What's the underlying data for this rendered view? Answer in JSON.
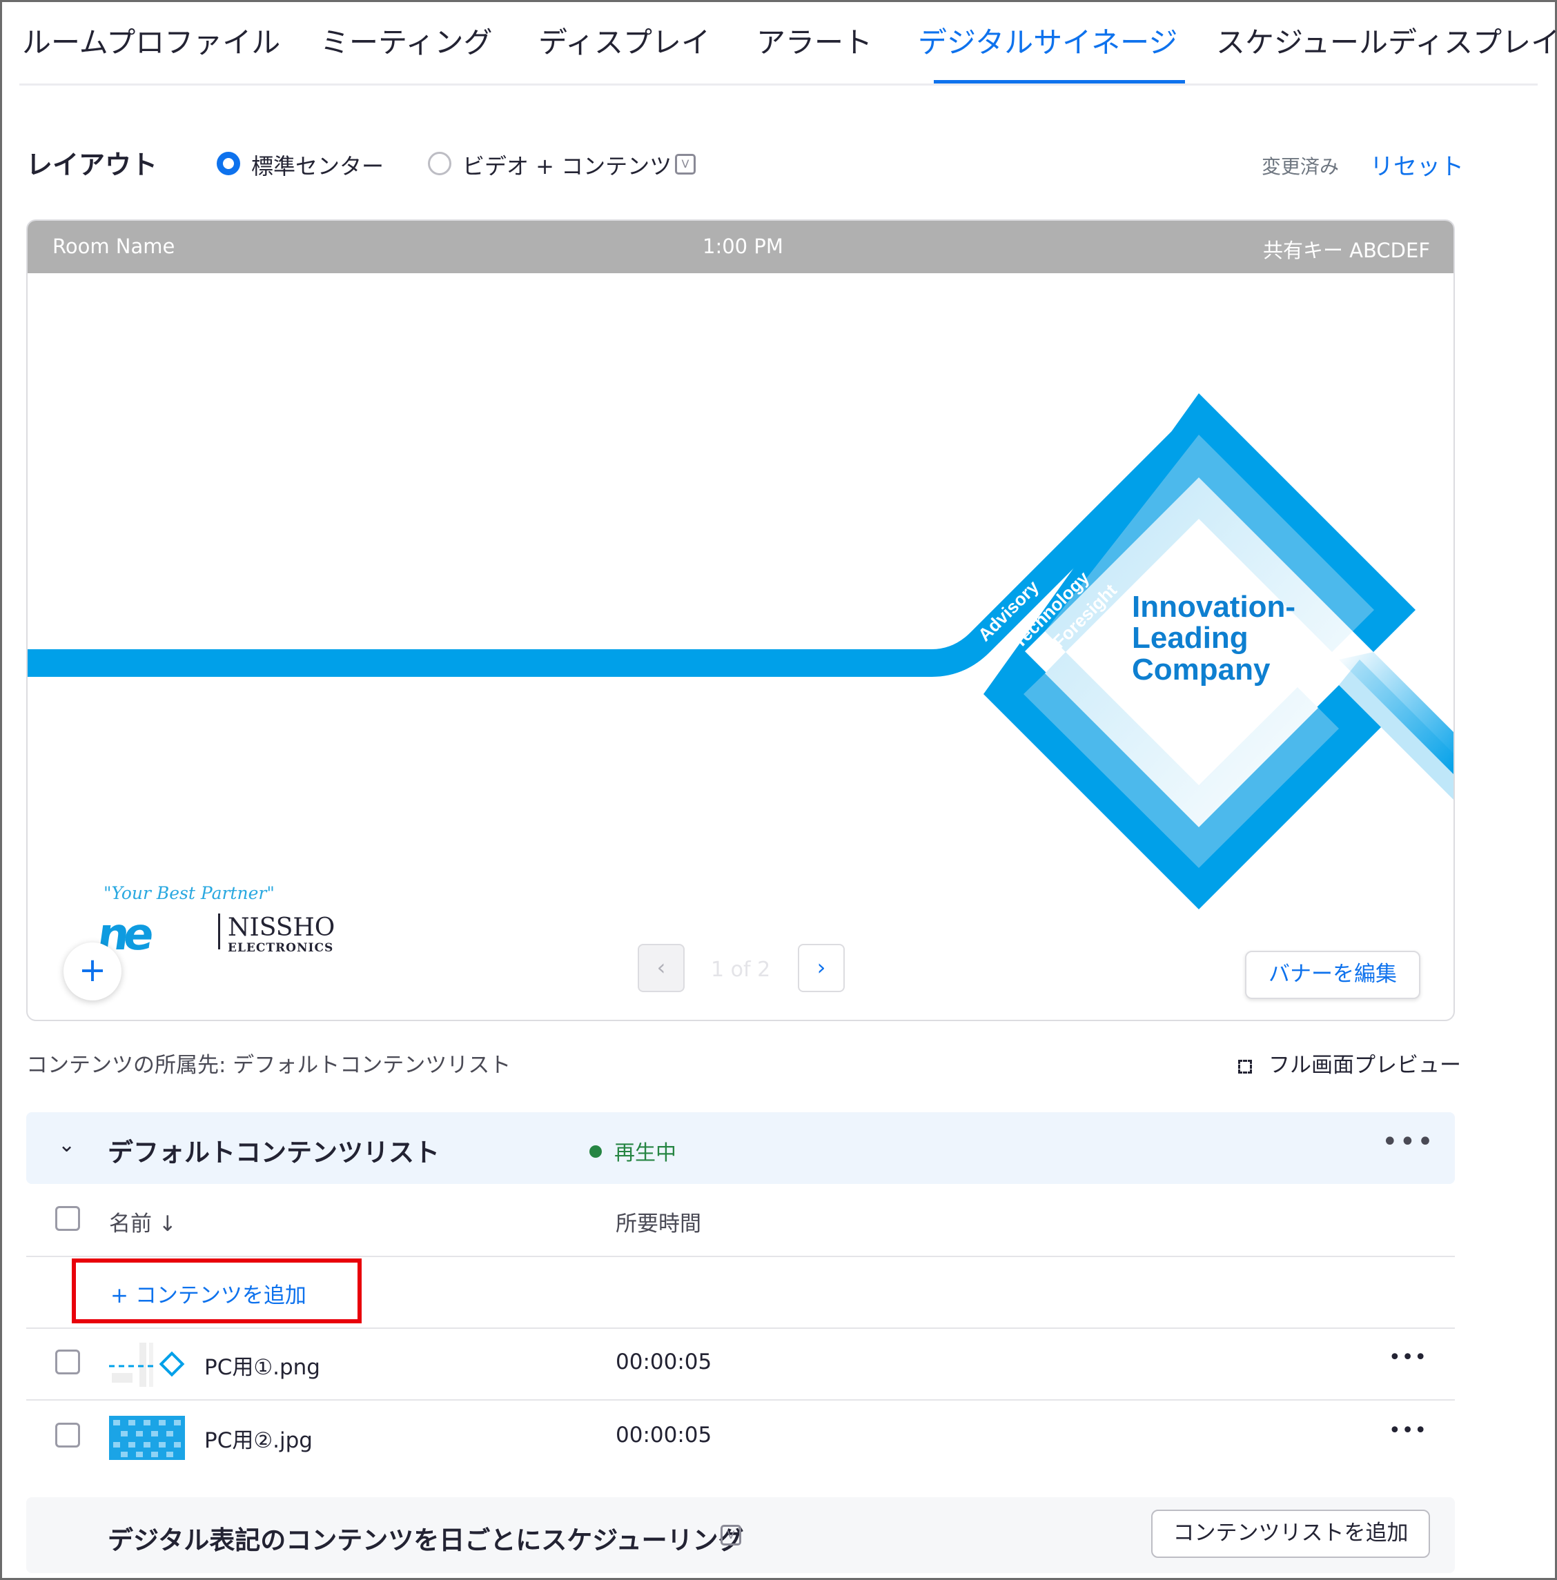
{
  "tabs": [
    {
      "label": "ルームプロファイル"
    },
    {
      "label": "ミーティング"
    },
    {
      "label": "ディスプレイ"
    },
    {
      "label": "アラート"
    },
    {
      "label": "デジタルサイネージ"
    },
    {
      "label": "スケジュールディスプレイ"
    }
  ],
  "active_tab": "デジタルサイネージ",
  "layout": {
    "label": "レイアウト",
    "option_standard": "標準センター",
    "option_video": "ビデオ + コンテンツ",
    "selected": "標準センター",
    "changed": "変更済み",
    "reset": "リセット"
  },
  "preview": {
    "room_name": "Room Name",
    "time": "1:00 PM",
    "share_key": "共有キー ABCDEF",
    "banner": {
      "word_1": "Advisory",
      "word_2": "Technology",
      "word_3": "Foresight",
      "headline_1": "Innovation-",
      "headline_2": "Leading",
      "headline_3": "Company"
    },
    "logo": {
      "tagline": "\"Your Best Partner\"",
      "mark": "ne",
      "name": "NISSHO",
      "sub": "ELECTRONICS"
    },
    "add_icon": "plus-icon",
    "pager_text": "1 of 2",
    "edit_banner": "バナーを編集"
  },
  "belongs_to": "コンテンツの所属先: デフォルトコンテンツリスト",
  "full_preview": "フル画面プレビュー",
  "content_list": {
    "title": "デフォルトコンテンツリスト",
    "status": "再生中",
    "col_name": "名前 ↓",
    "col_duration": "所要時間",
    "add_content": "+ コンテンツを追加",
    "items": [
      {
        "name": "PC用①.png",
        "duration": "00:00:05"
      },
      {
        "name": "PC用②.jpg",
        "duration": "00:00:05"
      }
    ]
  },
  "schedule": {
    "text": "デジタル表記のコンテンツを日ごとにスケジューリング",
    "add_list": "コンテンツリストを追加"
  },
  "colors": {
    "accent": "#0e72ed",
    "status_green": "#268543",
    "highlight_red": "#e8000b",
    "banner_blue": "#00a0e9"
  }
}
